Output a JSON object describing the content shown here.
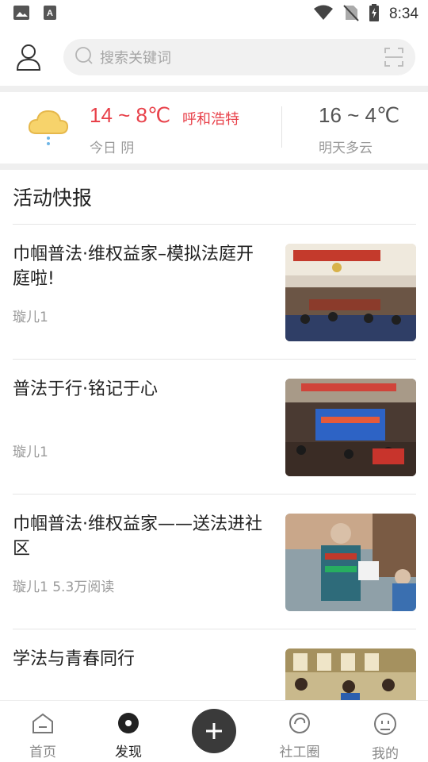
{
  "status_bar": {
    "time": "8:34",
    "icons": [
      "image-icon",
      "font-a-icon",
      "wifi-icon",
      "no-sim-icon",
      "battery-charging-icon"
    ]
  },
  "header": {
    "search_placeholder": "搜索关键词",
    "icons": [
      "user-icon",
      "search-icon",
      "scan-icon"
    ]
  },
  "weather": {
    "today_range": "14 ~ 8℃",
    "city": "呼和浩特",
    "today_label": "今日 阴",
    "tomorrow_range": "16 ~ 4℃",
    "tomorrow_label": "明天多云",
    "icon": "cloud-rain-icon"
  },
  "section": {
    "title": "活动快报"
  },
  "news": [
    {
      "title": "巾帼普法·维权益家–模拟法庭开庭啦!",
      "meta": "璇儿1"
    },
    {
      "title": "普法于行·铭记于心",
      "meta": "璇儿1"
    },
    {
      "title": "巾帼普法·维权益家——送法进社区",
      "meta": "璇儿1 5.3万阅读"
    },
    {
      "title": "学法与青春同行",
      "meta": ""
    }
  ],
  "tabbar": {
    "tabs": [
      {
        "label": "首页",
        "icon": "home-icon"
      },
      {
        "label": "发现",
        "icon": "discover-icon"
      },
      {
        "label": "",
        "icon": "plus-icon"
      },
      {
        "label": "社工圈",
        "icon": "circle-icon"
      },
      {
        "label": "我的",
        "icon": "profile-face-icon"
      }
    ],
    "active": "发现"
  },
  "colors": {
    "accent_red": "#e8414a",
    "tab_active": "#222222",
    "tab_inactive": "#888888"
  }
}
